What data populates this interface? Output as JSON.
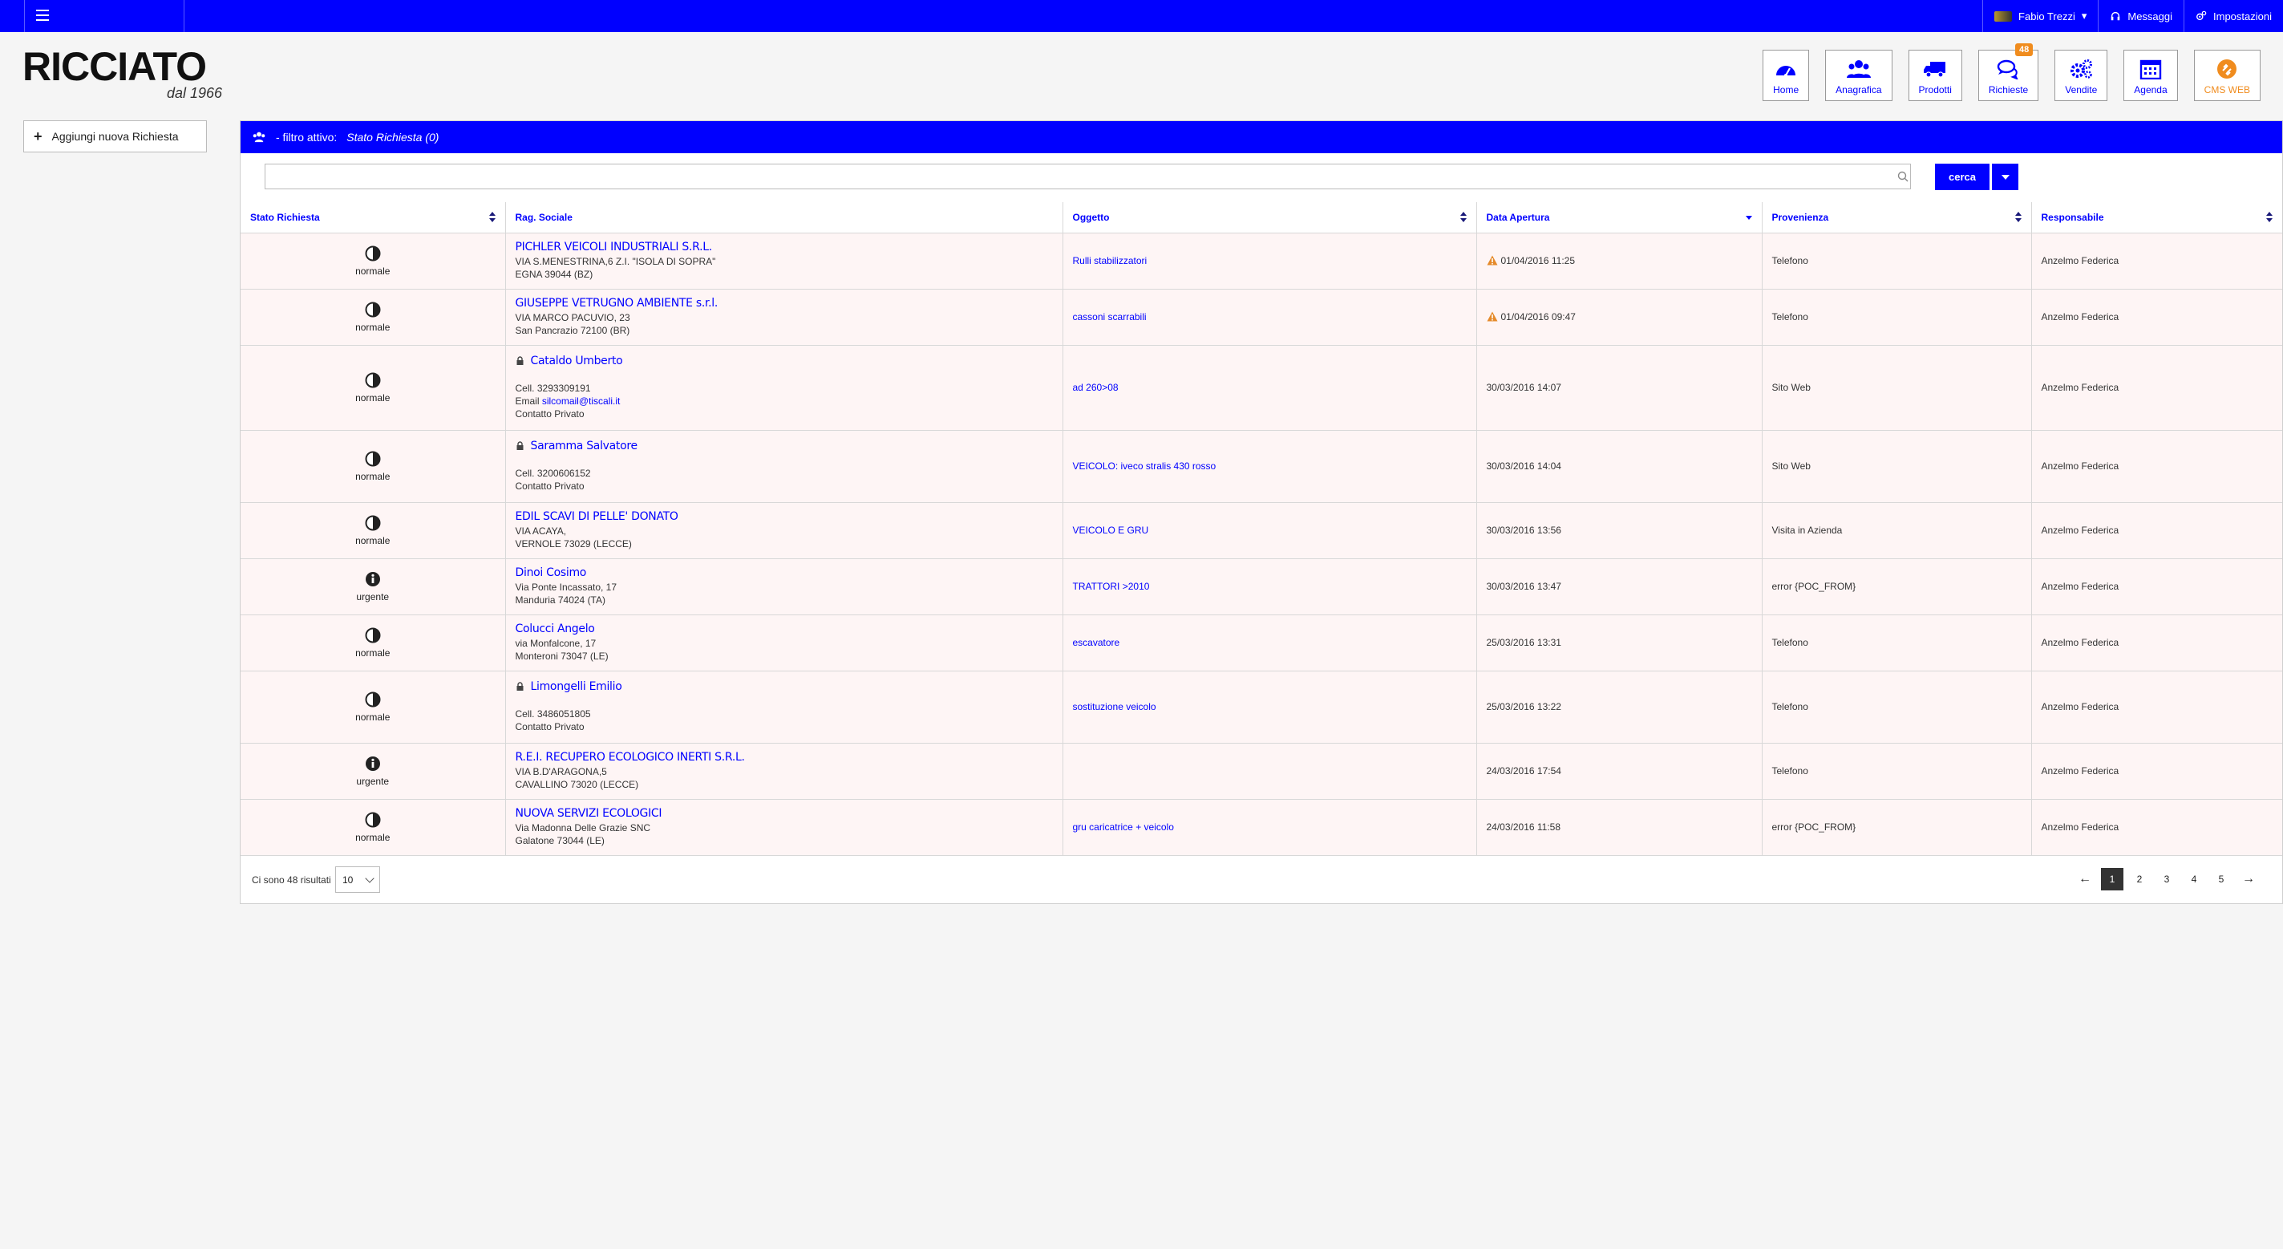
{
  "topbar": {
    "user": "Fabio Trezzi",
    "messages": "Messaggi",
    "settings": "Impostazioni"
  },
  "logo": {
    "brand": "RICCIATO",
    "sub": "dal 1966"
  },
  "nav": [
    {
      "label": "Home",
      "icon": "dashboard-icon"
    },
    {
      "label": "Anagrafica",
      "icon": "users-icon"
    },
    {
      "label": "Prodotti",
      "icon": "truck-icon"
    },
    {
      "label": "Richieste",
      "icon": "chat-icon",
      "badge": "48"
    },
    {
      "label": "Vendite",
      "icon": "gears-icon"
    },
    {
      "label": "Agenda",
      "icon": "calendar-icon"
    },
    {
      "label": "CMS WEB",
      "icon": "cms-icon"
    }
  ],
  "add_button": {
    "label": "Aggiungi nuova Richiesta"
  },
  "panel": {
    "filter_prefix": "- filtro attivo:",
    "filter_value": "Stato Richiesta (0)",
    "search_value": "",
    "search_button": "cerca"
  },
  "columns": [
    "Stato Richiesta",
    "Rag. Sociale",
    "Oggetto",
    "Data Apertura",
    "Provenienza",
    "Responsabile"
  ],
  "rows": [
    {
      "stato": "normale",
      "icon": "half-circle-icon",
      "private": false,
      "name": "PICHLER VEICOLI INDUSTRIALI S.R.L.",
      "lines": [
        "VIA S.MENESTRINA,6 Z.I. \"ISOLA DI SOPRA\"",
        "EGNA 39044 (BZ)"
      ],
      "oggetto": "Rulli stabilizzatori",
      "data": "01/04/2016 11:25",
      "warn": true,
      "provenienza": "Telefono",
      "responsabile": "Anzelmo Federica"
    },
    {
      "stato": "normale",
      "icon": "half-circle-icon",
      "private": false,
      "name": "GIUSEPPE VETRUGNO AMBIENTE s.r.l.",
      "lines": [
        "VIA MARCO PACUVIO, 23",
        "San Pancrazio 72100 (BR)"
      ],
      "oggetto": "cassoni scarrabili",
      "data": "01/04/2016 09:47",
      "warn": true,
      "provenienza": "Telefono",
      "responsabile": "Anzelmo Federica"
    },
    {
      "stato": "normale",
      "icon": "half-circle-icon",
      "private": true,
      "name": "Cataldo Umberto",
      "lines": [
        "",
        "Cell. 3293309191"
      ],
      "email_prefix": "Email ",
      "email": "silcomail@tiscali.it",
      "tail": "Contatto Privato",
      "oggetto": "ad 260>08",
      "data": "30/03/2016 14:07",
      "warn": false,
      "provenienza": "Sito Web",
      "responsabile": "Anzelmo Federica"
    },
    {
      "stato": "normale",
      "icon": "half-circle-icon",
      "private": true,
      "name": "Saramma Salvatore",
      "lines": [
        "",
        "Cell. 3200606152"
      ],
      "tail": "Contatto Privato",
      "oggetto": "VEICOLO: iveco stralis 430 rosso",
      "data": "30/03/2016 14:04",
      "warn": false,
      "provenienza": "Sito Web",
      "responsabile": "Anzelmo Federica"
    },
    {
      "stato": "normale",
      "icon": "half-circle-icon",
      "private": false,
      "name": "EDIL SCAVI DI PELLE' DONATO",
      "lines": [
        "VIA ACAYA,",
        "VERNOLE 73029 (LECCE)"
      ],
      "oggetto": "VEICOLO E GRU",
      "data": "30/03/2016 13:56",
      "warn": false,
      "provenienza": "Visita in Azienda",
      "responsabile": "Anzelmo Federica"
    },
    {
      "stato": "urgente",
      "icon": "info-icon",
      "private": false,
      "name": "Dinoi Cosimo",
      "lines": [
        "Via Ponte Incassato, 17",
        "Manduria 74024 (TA)"
      ],
      "oggetto": "TRATTORI >2010",
      "data": "30/03/2016 13:47",
      "warn": false,
      "provenienza": "error {POC_FROM}",
      "responsabile": "Anzelmo Federica"
    },
    {
      "stato": "normale",
      "icon": "half-circle-icon",
      "private": false,
      "name": "Colucci Angelo",
      "lines": [
        "via Monfalcone, 17",
        "Monteroni 73047 (LE)"
      ],
      "oggetto": "escavatore",
      "data": "25/03/2016 13:31",
      "warn": false,
      "provenienza": "Telefono",
      "responsabile": "Anzelmo Federica"
    },
    {
      "stato": "normale",
      "icon": "half-circle-icon",
      "private": true,
      "name": "Limongelli Emilio",
      "lines": [
        "",
        "Cell. 3486051805"
      ],
      "tail": "Contatto Privato",
      "oggetto": "sostituzione veicolo",
      "data": "25/03/2016 13:22",
      "warn": false,
      "provenienza": "Telefono",
      "responsabile": "Anzelmo Federica"
    },
    {
      "stato": "urgente",
      "icon": "info-icon",
      "private": false,
      "name": "R.E.I. RECUPERO ECOLOGICO INERTI S.R.L.",
      "lines": [
        "VIA B.D'ARAGONA,5",
        "CAVALLINO 73020 (LECCE)"
      ],
      "oggetto": "",
      "data": "24/03/2016 17:54",
      "warn": false,
      "provenienza": "Telefono",
      "responsabile": "Anzelmo Federica"
    },
    {
      "stato": "normale",
      "icon": "half-circle-icon",
      "private": false,
      "name": "NUOVA SERVIZI ECOLOGICI",
      "lines": [
        "Via Madonna Delle Grazie SNC",
        "Galatone 73044 (LE)"
      ],
      "oggetto": "gru caricatrice + veicolo",
      "data": "24/03/2016 11:58",
      "warn": false,
      "provenienza": "error {POC_FROM}",
      "responsabile": "Anzelmo Federica"
    }
  ],
  "footer": {
    "count_text": "Ci sono 48 risultati",
    "per_page": "10",
    "pages": [
      "1",
      "2",
      "3",
      "4",
      "5"
    ],
    "current_page": "1",
    "prev": "←",
    "next": "→"
  },
  "colors": {
    "primary": "#0000ff",
    "accent": "#f08c1e",
    "row_bg": "#fef5f5"
  }
}
